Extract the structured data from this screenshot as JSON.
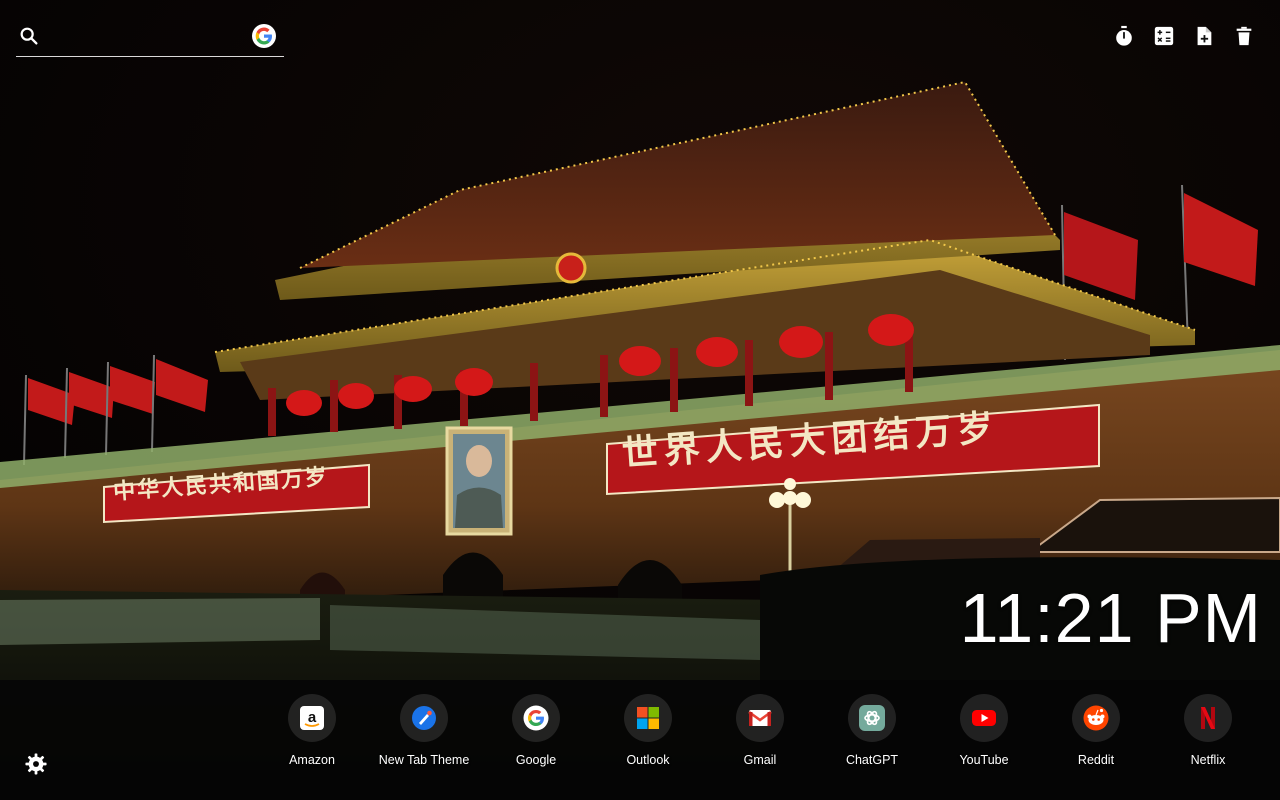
{
  "search": {
    "value": "",
    "placeholder": ""
  },
  "tools": [
    {
      "name": "timer-icon"
    },
    {
      "name": "calculator-icon"
    },
    {
      "name": "add-note-icon"
    },
    {
      "name": "trash-icon"
    }
  ],
  "clock": {
    "time": "11:21 PM"
  },
  "banners": {
    "left": "中华人民共和国万岁",
    "right": "世界人民大团结万岁"
  },
  "shortcuts": [
    {
      "label": "Amazon",
      "icon": "amazon-icon"
    },
    {
      "label": "New Tab Theme",
      "icon": "new-tab-theme-icon"
    },
    {
      "label": "Google",
      "icon": "google-icon"
    },
    {
      "label": "Outlook",
      "icon": "microsoft-icon"
    },
    {
      "label": "Gmail",
      "icon": "gmail-icon"
    },
    {
      "label": "ChatGPT",
      "icon": "chatgpt-icon"
    },
    {
      "label": "YouTube",
      "icon": "youtube-icon"
    },
    {
      "label": "Reddit",
      "icon": "reddit-icon"
    },
    {
      "label": "Netflix",
      "icon": "netflix-icon"
    }
  ],
  "colors": {
    "banner_red": "#b5161a",
    "banner_text": "#f3e7c4",
    "wall": "#6b3b18",
    "roof_glow": "#e6b93a"
  }
}
